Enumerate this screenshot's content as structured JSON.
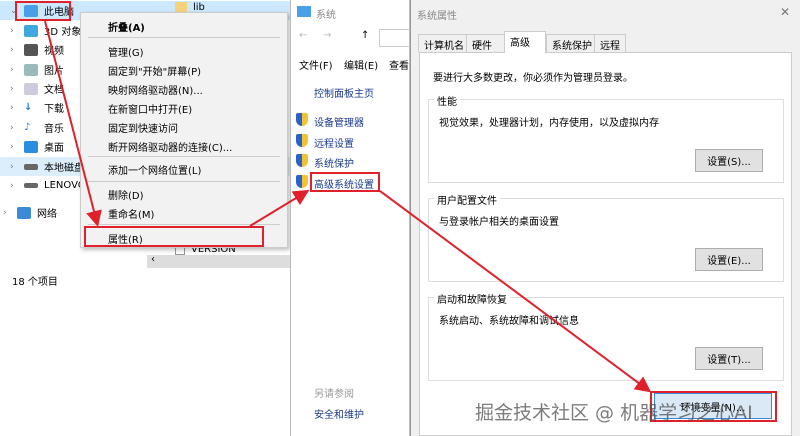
{
  "explorer": {
    "tree": [
      {
        "label": "此电脑",
        "expanded": true,
        "selected": true
      },
      {
        "label": "3D 对象"
      },
      {
        "label": "视频"
      },
      {
        "label": "图片"
      },
      {
        "label": "文档"
      },
      {
        "label": "下载"
      },
      {
        "label": "音乐"
      },
      {
        "label": "桌面"
      },
      {
        "label": "本地磁盘"
      },
      {
        "label": "LENOVO"
      },
      {
        "label": "网络"
      }
    ],
    "files": [
      "lib",
      "VERSION"
    ],
    "status": "18 个项目"
  },
  "context_menu": {
    "items": [
      "折叠(A)",
      "管理(G)",
      "固定到\"开始\"屏幕(P)",
      "映射网络驱动器(N)...",
      "在新窗口中打开(E)",
      "固定到快速访问",
      "断开网络驱动器的连接(C)...",
      "添加一个网络位置(L)",
      "删除(D)",
      "重命名(M)",
      "属性(R)"
    ]
  },
  "system_window": {
    "title": "系统",
    "menu": [
      "文件(F)",
      "编辑(E)",
      "查看"
    ],
    "home_link": "控制面板主页",
    "links": [
      "设备管理器",
      "远程设置",
      "系统保护",
      "高级系统设置"
    ],
    "see_also": "另请参阅",
    "see_also_link": "安全和维护"
  },
  "dialog": {
    "title": "系统属性",
    "close": "✕",
    "tabs": [
      "计算机名",
      "硬件",
      "高级",
      "系统保护",
      "远程"
    ],
    "active_tab": "高级",
    "notice": "要进行大多数更改，你必须作为管理员登录。",
    "groups": [
      {
        "label": "性能",
        "desc": "视觉效果，处理器计划，内存使用，以及虚拟内存",
        "button": "设置(S)..."
      },
      {
        "label": "用户配置文件",
        "desc": "与登录帐户相关的桌面设置",
        "button": "设置(E)..."
      },
      {
        "label": "启动和故障恢复",
        "desc": "系统启动、系统故障和调试信息",
        "button": "设置(T)..."
      }
    ],
    "env_button": "环境变量(N)..."
  },
  "watermark": "掘金技术社区 @ 机器学习之心AI",
  "colors": {
    "annotation": "#e0202a",
    "selection": "#cce8ff",
    "link": "#1a3a8a"
  }
}
